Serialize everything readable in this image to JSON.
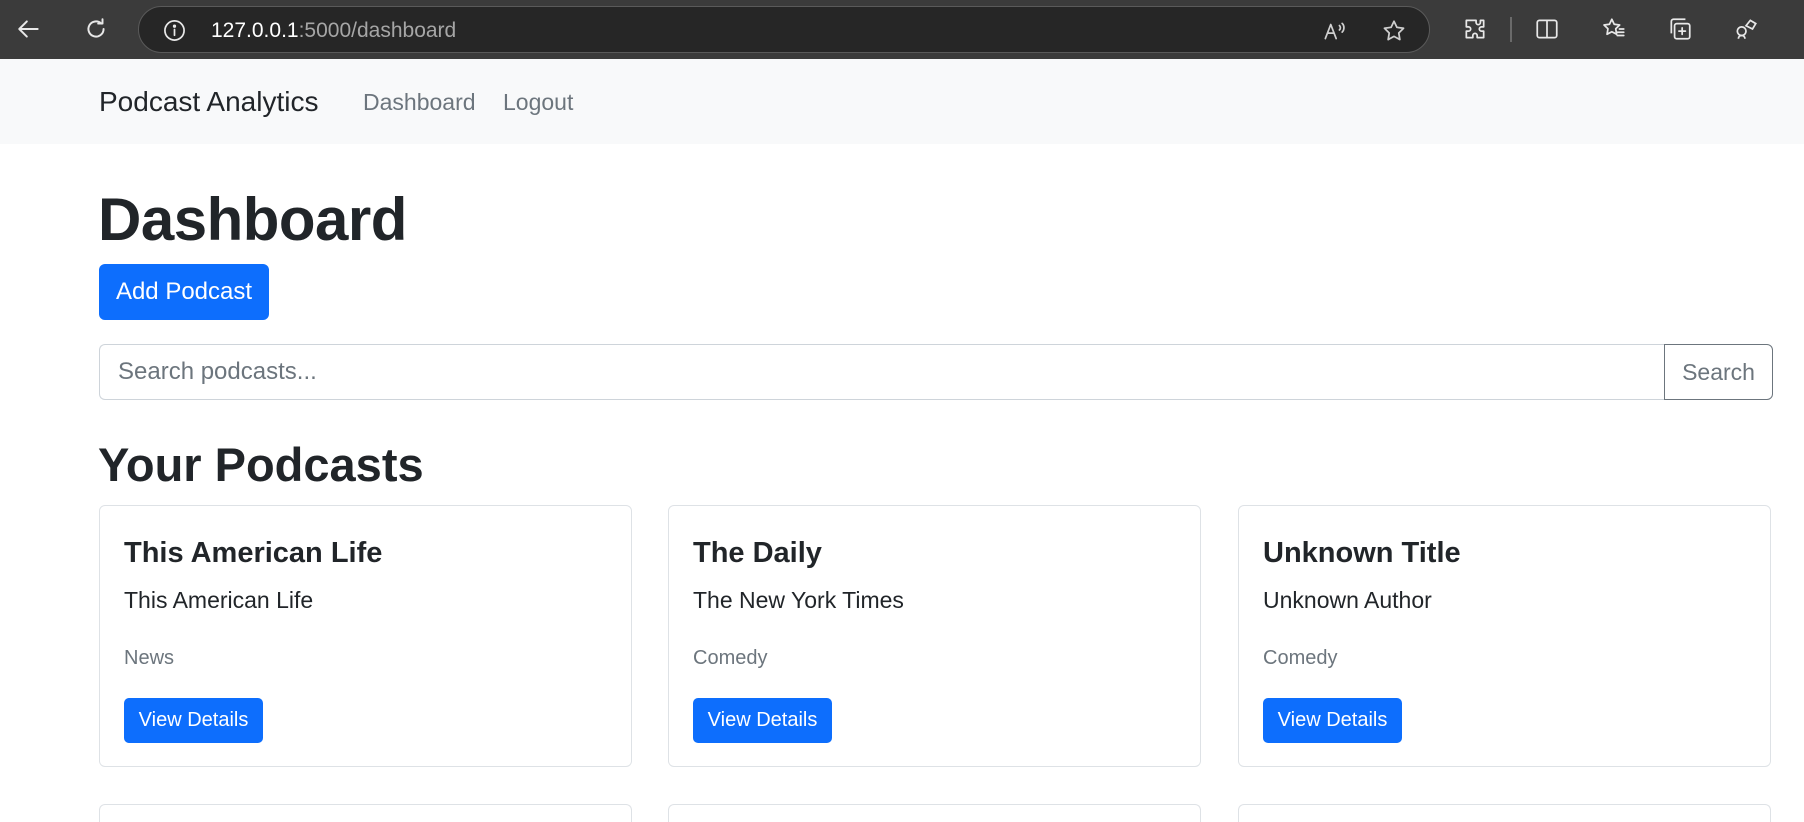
{
  "browser": {
    "url_host": "127.0.0.1",
    "url_rest": ":5000/dashboard",
    "icons": [
      "back-icon",
      "refresh-icon",
      "info-icon",
      "read-aloud-icon",
      "favorite-star-icon",
      "extensions-icon",
      "split-screen-icon",
      "favorites-icon",
      "collections-icon",
      "browser-essentials-icon"
    ]
  },
  "navbar": {
    "brand": "Podcast Analytics",
    "links": [
      "Dashboard",
      "Logout"
    ]
  },
  "main": {
    "title": "Dashboard",
    "add_button": "Add Podcast",
    "search_placeholder": "Search podcasts...",
    "search_button": "Search",
    "section_title": "Your Podcasts",
    "podcasts": [
      {
        "title": "This American Life",
        "author": "This American Life",
        "genre": "News",
        "button": "View Details"
      },
      {
        "title": "The Daily",
        "author": "The New York Times",
        "genre": "Comedy",
        "button": "View Details"
      },
      {
        "title": "Unknown Title",
        "author": "Unknown Author",
        "genre": "Comedy",
        "button": "View Details"
      }
    ]
  },
  "colors": {
    "primary": "#0d6efd",
    "navbar_bg": "#f8f9fa",
    "browser_bg": "#3b3b3b",
    "muted": "#6c757d"
  }
}
